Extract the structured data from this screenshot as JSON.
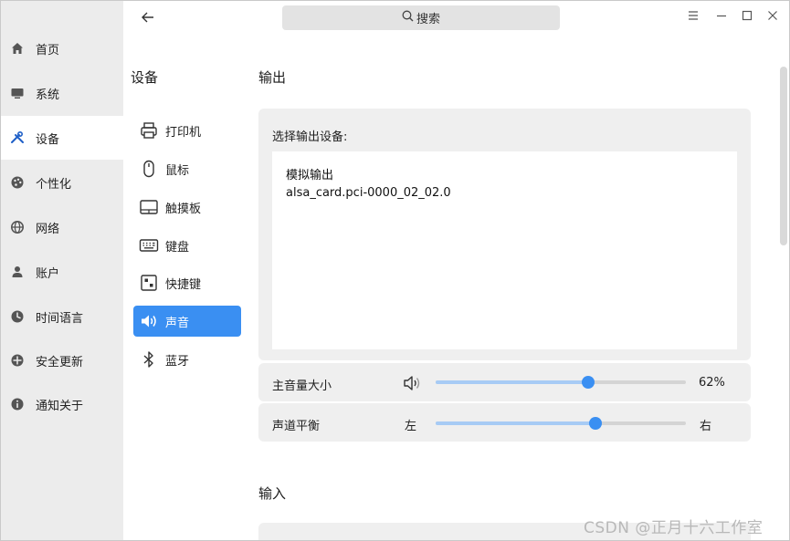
{
  "header": {
    "search_placeholder": "搜索",
    "icons": [
      "back-arrow-icon",
      "search-icon",
      "menu-icon",
      "minimize-icon",
      "maximize-icon",
      "close-icon"
    ]
  },
  "sidebar": {
    "items": [
      {
        "label": "首页",
        "icon": "home-icon",
        "active": false
      },
      {
        "label": "系统",
        "icon": "monitor-icon",
        "active": false
      },
      {
        "label": "设备",
        "icon": "tools-icon",
        "active": true
      },
      {
        "label": "个性化",
        "icon": "palette-icon",
        "active": false
      },
      {
        "label": "网络",
        "icon": "globe-icon",
        "active": false
      },
      {
        "label": "账户",
        "icon": "user-icon",
        "active": false
      },
      {
        "label": "时间语言",
        "icon": "clock-icon",
        "active": false
      },
      {
        "label": "安全更新",
        "icon": "shield-icon",
        "active": false
      },
      {
        "label": "通知关于",
        "icon": "info-icon",
        "active": false
      }
    ]
  },
  "devices": {
    "title": "设备",
    "items": [
      {
        "label": "打印机",
        "icon": "printer-icon",
        "active": false
      },
      {
        "label": "鼠标",
        "icon": "mouse-icon",
        "active": false
      },
      {
        "label": "触摸板",
        "icon": "touchpad-icon",
        "active": false
      },
      {
        "label": "键盘",
        "icon": "keyboard-icon",
        "active": false
      },
      {
        "label": "快捷键",
        "icon": "shortcut-icon",
        "active": false
      },
      {
        "label": "声音",
        "icon": "sound-icon",
        "active": true
      },
      {
        "label": "蓝牙",
        "icon": "bluetooth-icon",
        "active": false
      }
    ]
  },
  "output": {
    "title": "输出",
    "device_label": "选择输出设备:",
    "device": {
      "name": "模拟输出",
      "id": "alsa_card.pci-0000_02_02.0"
    },
    "volume": {
      "label": "主音量大小",
      "value": 0.61,
      "value_text": "62%"
    },
    "balance": {
      "label": "声道平衡",
      "left_label": "左",
      "right_label": "右",
      "value": 0.64
    }
  },
  "input": {
    "title": "输入"
  },
  "watermark": "CSDN @正月十六工作室",
  "colors": {
    "accent": "#3a8ff2",
    "sidebar_bg": "#ececec",
    "card_bg": "#efefef"
  }
}
